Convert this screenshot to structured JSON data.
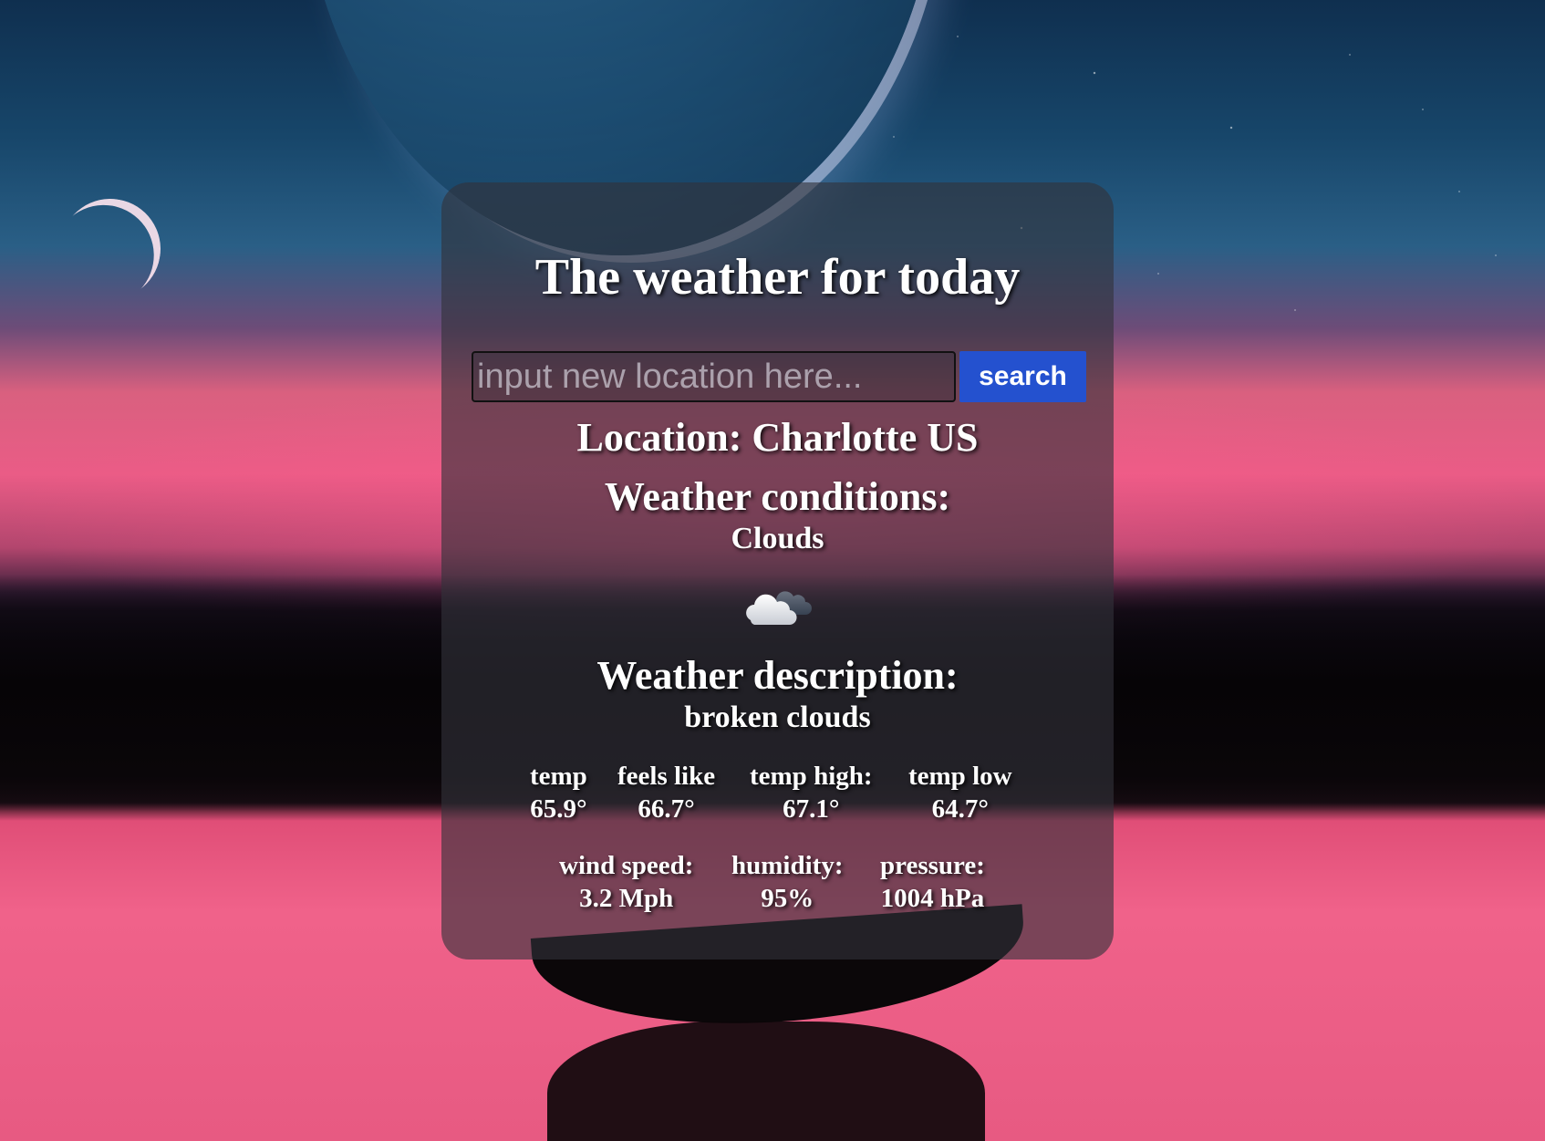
{
  "page": {
    "title": "The weather for today"
  },
  "search": {
    "placeholder": "input new location here...",
    "button_label": "search"
  },
  "location": {
    "text": "Location: Charlotte US"
  },
  "conditions": {
    "label": "Weather conditions:",
    "value": "Clouds",
    "icon": "cloud-icon"
  },
  "description": {
    "label": "Weather description:",
    "value": "broken clouds"
  },
  "temperatures": [
    {
      "label": "temp",
      "value": "65.9°"
    },
    {
      "label": "feels like",
      "value": "66.7°"
    },
    {
      "label": "temp high:",
      "value": "67.1°"
    },
    {
      "label": "temp low",
      "value": "64.7°"
    }
  ],
  "atmosphere": [
    {
      "label": "wind speed:",
      "value": "3.2 Mph"
    },
    {
      "label": "humidity:",
      "value": "95%"
    },
    {
      "label": "pressure:",
      "value": "1004 hPa"
    }
  ],
  "colors": {
    "button": "#2451cf",
    "card": "rgba(50,50,58,0.62)",
    "text": "#ffffff"
  }
}
